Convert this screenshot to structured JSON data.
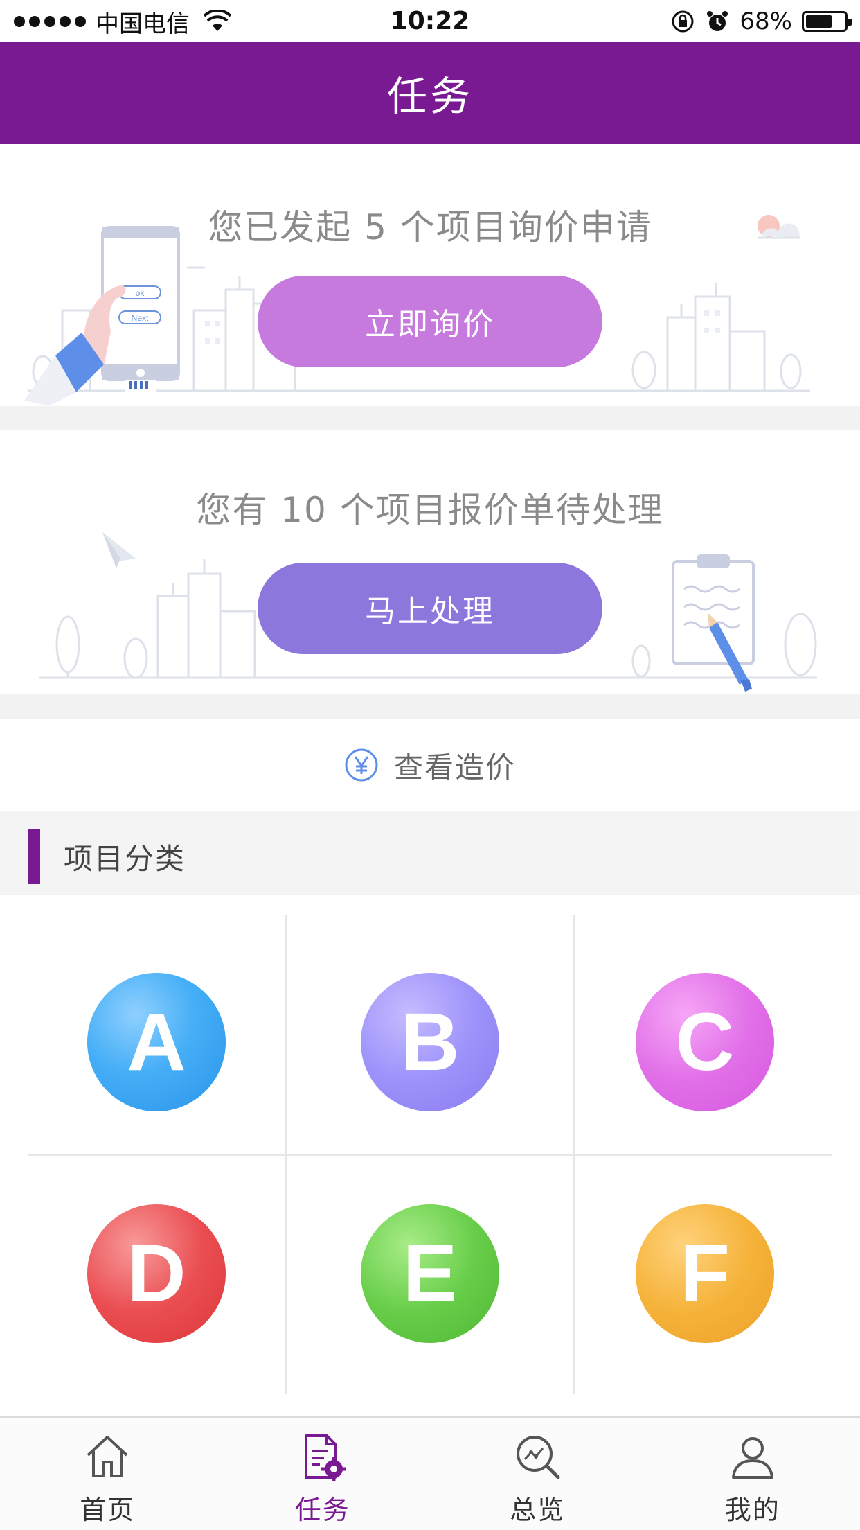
{
  "status_bar": {
    "carrier": "中国电信",
    "time": "10:22",
    "battery": "68%",
    "battery_level": 0.68
  },
  "header": {
    "title": "任务"
  },
  "inquiry_card": {
    "text": "您已发起 5 个项目询价申请",
    "button": "立即询价",
    "phone_ok": "ok",
    "phone_next": "Next"
  },
  "quote_card": {
    "text": "您有 10 个项目报价单待处理",
    "button": "马上处理"
  },
  "price_row": {
    "icon": "yen-icon",
    "label": "查看造价"
  },
  "section": {
    "title": "项目分类"
  },
  "categories": [
    {
      "letter": "A",
      "color": "#3fa8f5"
    },
    {
      "letter": "B",
      "color": "#9d92fa"
    },
    {
      "letter": "C",
      "color": "#e170e8"
    },
    {
      "letter": "D",
      "color": "#ea4e52"
    },
    {
      "letter": "E",
      "color": "#62c844"
    },
    {
      "letter": "F",
      "color": "#f2ab35"
    }
  ],
  "tabs": [
    {
      "label": "首页",
      "icon": "home-icon"
    },
    {
      "label": "任务",
      "icon": "task-icon",
      "active": true
    },
    {
      "label": "总览",
      "icon": "overview-icon"
    },
    {
      "label": "我的",
      "icon": "profile-icon"
    }
  ],
  "colors": {
    "brand": "#7a1a92",
    "inquiry_button": "#c77ade",
    "process_button": "#8c78dc"
  }
}
